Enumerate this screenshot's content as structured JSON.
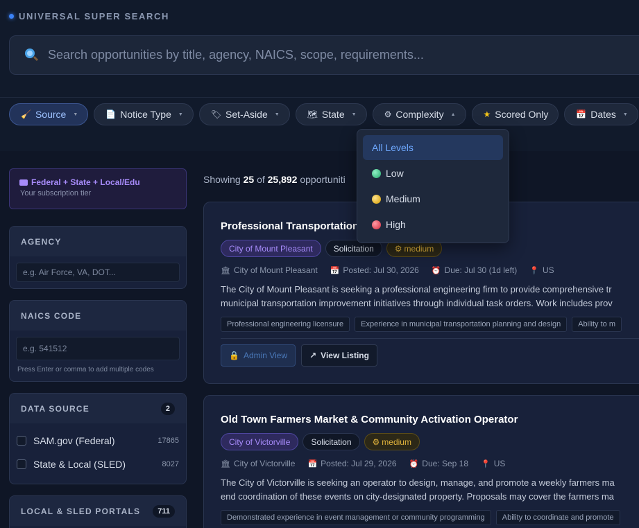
{
  "header": {
    "brand": "UNIVERSAL SUPER SEARCH"
  },
  "search": {
    "placeholder": "Search opportunities by title, agency, NAICS, scope, requirements..."
  },
  "filters": [
    {
      "label": "Source",
      "icon": "broom-icon"
    },
    {
      "label": "Notice Type",
      "icon": "document-icon"
    },
    {
      "label": "Set-Aside",
      "icon": "tag-icon"
    },
    {
      "label": "State",
      "icon": "map-icon"
    },
    {
      "label": "Complexity",
      "icon": "gear-icon"
    },
    {
      "label": "Scored Only",
      "icon": "star-icon"
    },
    {
      "label": "Dates",
      "icon": "calendar-icon"
    }
  ],
  "complexity_dropdown": {
    "items": [
      {
        "label": "All Levels",
        "color": ""
      },
      {
        "label": "Low",
        "color": "#34c38f"
      },
      {
        "label": "Medium",
        "color": "#eab308"
      },
      {
        "label": "High",
        "color": "#ef4444"
      }
    ]
  },
  "sidebar": {
    "tier": {
      "title": "Federal + State + Local/Edu",
      "subtitle": "Your subscription tier"
    },
    "agency": {
      "header": "AGENCY",
      "placeholder": "e.g. Air Force, VA, DOT..."
    },
    "naics": {
      "header": "NAICS CODE",
      "placeholder": "e.g. 541512",
      "hint": "Press Enter or comma to add multiple codes"
    },
    "data_source": {
      "header": "DATA SOURCE",
      "count": "2",
      "items": [
        {
          "label": "SAM.gov (Federal)",
          "count": "17865"
        },
        {
          "label": "State & Local (SLED)",
          "count": "8027"
        }
      ]
    },
    "portals": {
      "header": "LOCAL & SLED PORTALS",
      "count": "711"
    }
  },
  "results": {
    "showing_prefix": "Showing",
    "shown": "25",
    "of": "of",
    "total": "25,892",
    "suffix": "opportuniti"
  },
  "cards": [
    {
      "title": "Professional Transportation",
      "agency": "City of Mount Pleasant",
      "type": "Solicitation",
      "complexity": "medium",
      "meta_agency": "City of Mount Pleasant",
      "posted": "Posted: Jul 30, 2026",
      "due": "Due: Jul 30 (1d left)",
      "location": "US",
      "desc1": "The City of Mount Pleasant is seeking a professional engineering firm to provide comprehensive tr",
      "desc2": "municipal transportation improvement initiatives through individual task orders. Work includes prov",
      "reqs": [
        "Professional engineering licensure",
        "Experience in municipal transportation planning and design",
        "Ability to m"
      ],
      "admin_label": "Admin View",
      "view_label": "View Listing"
    },
    {
      "title": "Old Town Farmers Market & Community Activation Operator",
      "agency": "City of Victorville",
      "type": "Solicitation",
      "complexity": "medium",
      "meta_agency": "City of Victorville",
      "posted": "Posted: Jul 29, 2026",
      "due": "Due: Sep 18",
      "location": "US",
      "desc1": "The City of Victorville is seeking an operator to design, manage, and promote a weekly farmers ma",
      "desc2": "end coordination of these events on city-designated property. Proposals may cover the farmers ma",
      "reqs": [
        "Demonstrated experience in event management or community programming",
        "Ability to coordinate and promote"
      ]
    }
  ]
}
